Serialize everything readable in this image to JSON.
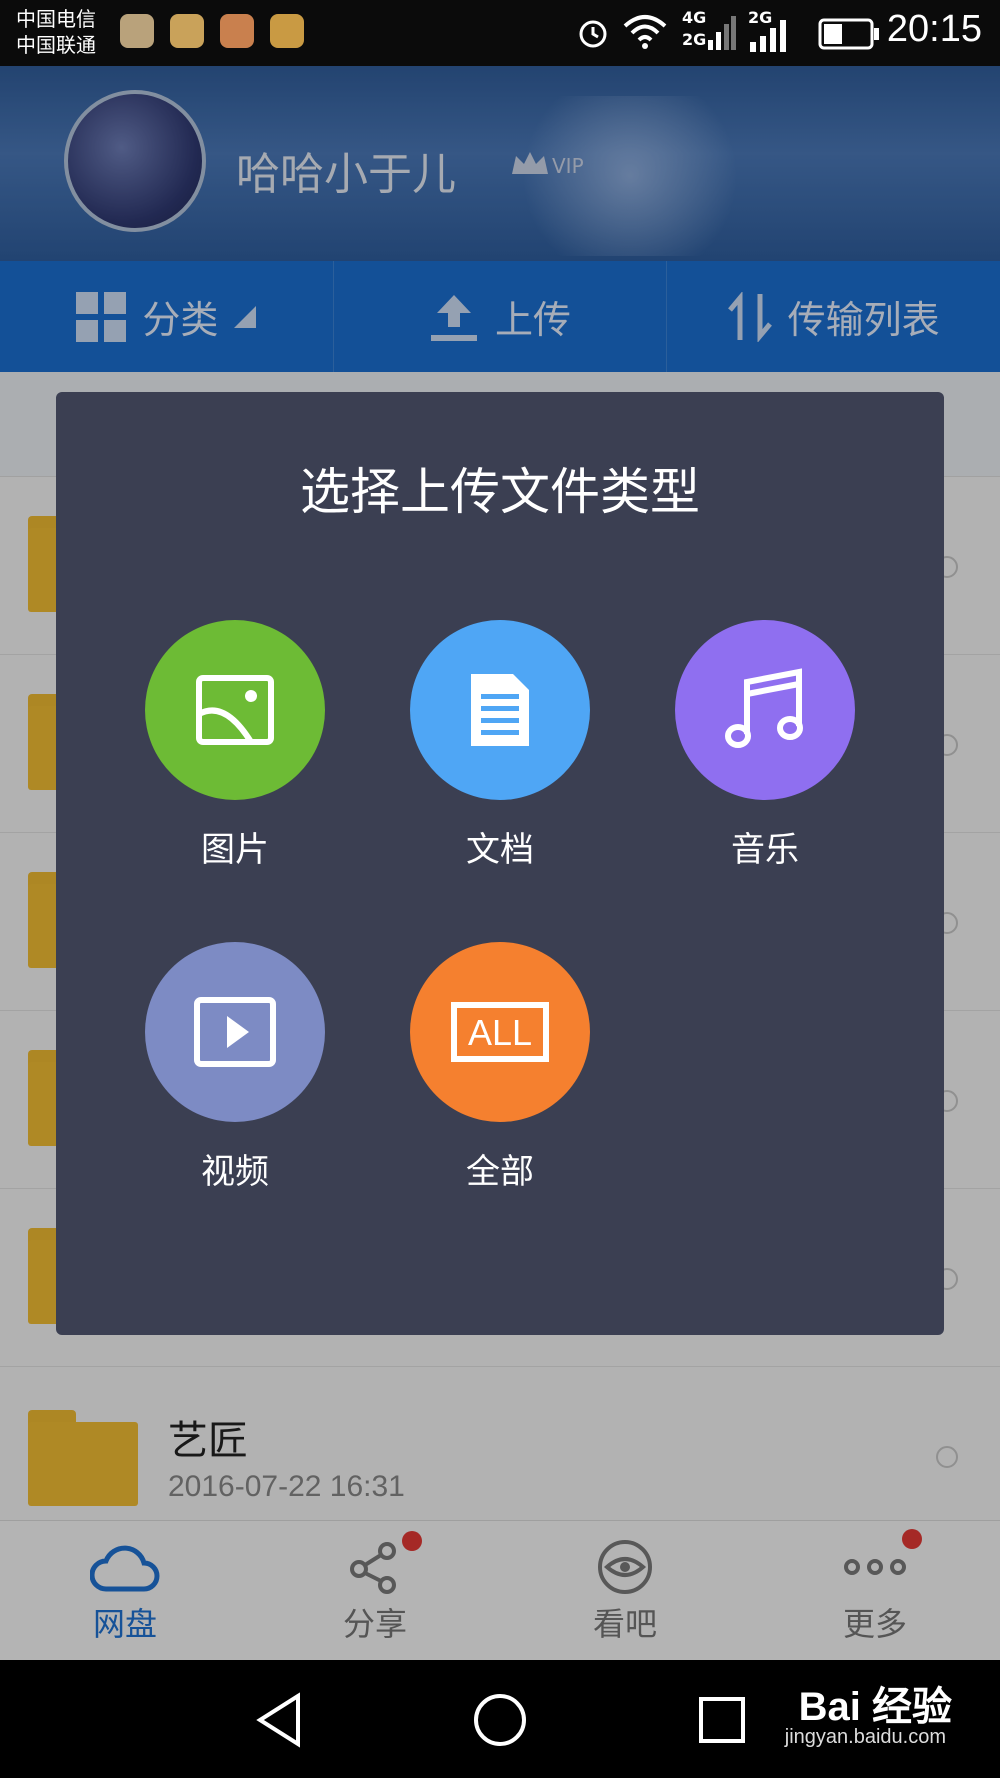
{
  "status_bar": {
    "carrier1": "中国电信",
    "carrier2": "中国联通",
    "net1": "4G",
    "net1b": "2G",
    "net2": "2G",
    "time": "20:15"
  },
  "header": {
    "username": "哈哈小于儿",
    "vip_label": "VIP"
  },
  "toolbar": {
    "category": "分类",
    "upload": "上传",
    "transfer_list": "传输列表"
  },
  "list": {
    "last_item": {
      "name": "艺匠",
      "date": "2016-07-22  16:31"
    }
  },
  "dialog": {
    "title": "选择上传文件类型",
    "options": [
      {
        "label": "图片",
        "icon": "image-icon",
        "color": "#6dbb35"
      },
      {
        "label": "文档",
        "icon": "document-icon",
        "color": "#4fa6f5"
      },
      {
        "label": "音乐",
        "icon": "music-icon",
        "color": "#8f6ff0"
      },
      {
        "label": "视频",
        "icon": "video-icon",
        "color": "#7d8bc4"
      },
      {
        "label": "全部",
        "icon": "all-icon",
        "color": "#f5802f"
      }
    ]
  },
  "bottom_nav": {
    "items": [
      {
        "label": "网盘",
        "icon": "cloud-icon"
      },
      {
        "label": "分享",
        "icon": "share-icon"
      },
      {
        "label": "看吧",
        "icon": "eye-icon"
      },
      {
        "label": "更多",
        "icon": "more-icon"
      }
    ]
  },
  "watermark": {
    "main": "Bai 经验",
    "sub": "jingyan.baidu.com"
  }
}
